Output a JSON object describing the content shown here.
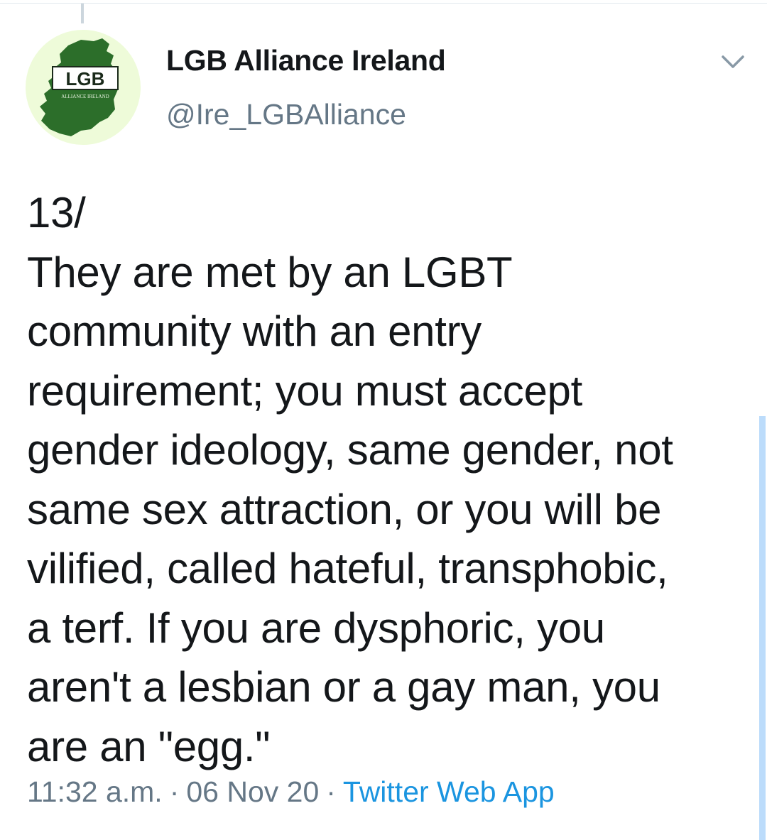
{
  "tweet": {
    "display_name": "LGB Alliance Ireland",
    "handle": "@Ire_LGBAlliance",
    "avatar": {
      "icon": "ireland-map-logo-icon",
      "logo_text": "LGB",
      "logo_subtext": "ALLIANCE IRELAND",
      "background_color": "#eefbd9",
      "map_color": "#2c6e2a"
    },
    "text": "13/\nThey are met by an LGBT\ncommunity with an entry\nrequirement; you must accept\ngender ideology, same gender, not\nsame sex attraction, or you will be\nvilified, called hateful, transphobic,\na terf. If you are dysphoric, you\naren't a lesbian or a gay man, you\nare an \"egg.\"",
    "time": "11:32 a.m.",
    "date": "06 Nov 20",
    "separator": "·",
    "source": "Twitter Web App",
    "menu_icon": "chevron-down-icon"
  },
  "colors": {
    "text": "#14171a",
    "secondary": "#657786",
    "link": "#1b95e0"
  }
}
